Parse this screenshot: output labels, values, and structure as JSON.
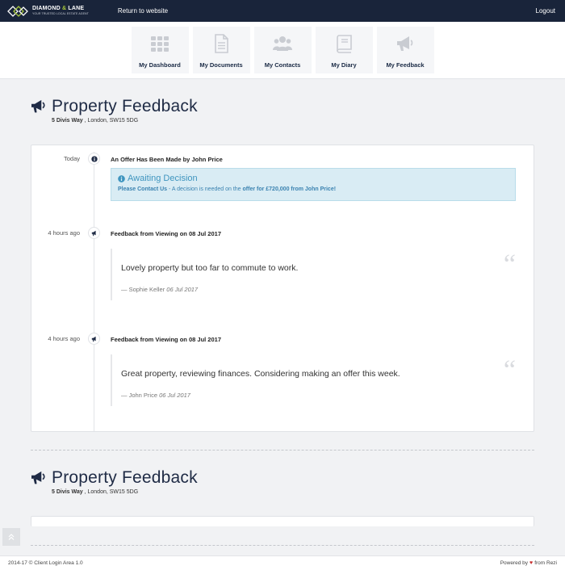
{
  "topbar": {
    "logo_name_1": "DIAMOND",
    "logo_amp": "&",
    "logo_name_2": "LANE",
    "logo_tagline": "YOUR TRUSTED LOCAL ESTATE AGENT",
    "return_label": "Return to website",
    "logout_label": "Logout"
  },
  "nav": {
    "items": [
      {
        "label": "My Dashboard",
        "icon": "grid-icon"
      },
      {
        "label": "My Documents",
        "icon": "document-icon"
      },
      {
        "label": "My Contacts",
        "icon": "users-icon"
      },
      {
        "label": "My Diary",
        "icon": "book-icon"
      },
      {
        "label": "My Feedback",
        "icon": "megaphone-icon"
      }
    ]
  },
  "sections": [
    {
      "title": "Property Feedback",
      "address_street": "5 Divis Way",
      "address_rest": " , London, SW15 5DG"
    },
    {
      "title": "Property Feedback",
      "address_street": "5 Divis Way",
      "address_rest": " , London, SW15 5DG"
    }
  ],
  "events": [
    {
      "time": "Today",
      "title": "An Offer Has Been Made by John Price",
      "alert_heading": "Awaiting Decision",
      "alert_link": "Please Contact Us",
      "alert_mid": " - A decision is needed on the ",
      "alert_offer": "offer for £720,000 from John Price!"
    },
    {
      "time": "4 hours ago",
      "title": "Feedback from Viewing on 08 Jul 2017",
      "quote": "Lovely property but too far to commute to work.",
      "author": "— Sophie Keller",
      "date": "06 Jul 2017"
    },
    {
      "time": "4 hours ago",
      "title": "Feedback from Viewing on 08 Jul 2017",
      "quote": "Great property, reviewing finances. Considering making an offer this week.",
      "author": "— John Price",
      "date": "06 Jul 2017"
    }
  ],
  "quote_glyph": "“",
  "footer": {
    "left": "2014-17 © Client Login Area 1.0",
    "right_prefix": "Powered by",
    "heart": "♥",
    "right_suffix": "from Rezi"
  },
  "colors": {
    "topbar": "#19243a",
    "accent_green": "#a7c83b",
    "alert_bg": "#d9ecf4",
    "alert_text": "#3a82b0"
  }
}
